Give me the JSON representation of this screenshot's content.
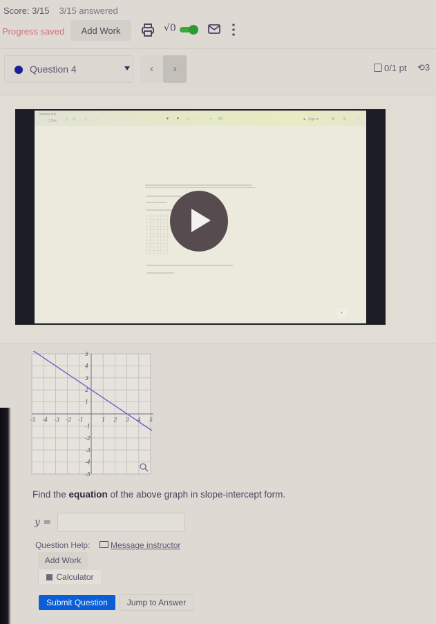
{
  "header": {
    "score": "Score: 3/15",
    "answered": "3/15 answered",
    "progress_status": "Progress saved",
    "add_work_label": "Add Work",
    "sqrt_label": "√0",
    "toggle_state": "on",
    "icons": [
      "printer-icon",
      "sqrt-icon",
      "toggle",
      "mail-icon",
      "kebab-menu-icon"
    ],
    "colors": {
      "progress": "#d4707a",
      "toggle": "#2f9a34"
    }
  },
  "question_nav": {
    "selected": "Question 4",
    "status_dot_color": "#1d1f9a",
    "prev_label": "‹",
    "next_label": "›",
    "points": "0/1 pt",
    "retries": "3"
  },
  "video": {
    "title": "Graphing Text",
    "toolbar_left": "1 Sec",
    "toolbar_right": "Sign in",
    "play_label": "Play video"
  },
  "graph": {
    "x_ticks": [
      "-5",
      "-4",
      "-3",
      "-2",
      "-1",
      "1",
      "2",
      "3",
      "4",
      "5"
    ],
    "y_ticks": [
      "5",
      "4",
      "3",
      "2",
      "1",
      "-1",
      "-2",
      "-3",
      "-4",
      "-5"
    ],
    "xlim": [
      -5,
      5
    ],
    "ylim": [
      -5,
      5
    ],
    "line": {
      "slope": -0.6667,
      "intercept": 2,
      "color": "#6a63c8"
    }
  },
  "chart_data": {
    "type": "line",
    "title": "",
    "xlabel": "",
    "ylabel": "",
    "xlim": [
      -5,
      5
    ],
    "ylim": [
      -5,
      5
    ],
    "grid": true,
    "x_ticks": [
      -5,
      -4,
      -3,
      -2,
      -1,
      1,
      2,
      3,
      4,
      5
    ],
    "y_ticks": [
      5,
      4,
      3,
      2,
      1,
      -1,
      -2,
      -3,
      -4,
      -5
    ],
    "series": [
      {
        "name": "line",
        "x": [
          -5,
          0,
          3,
          5
        ],
        "y": [
          5.33,
          2,
          0,
          -1.33
        ]
      }
    ]
  },
  "question": {
    "prompt_before": "Find the ",
    "prompt_bold": "equation",
    "prompt_after": " of the above graph in slope-intercept form.",
    "y_label": "y =",
    "answer_value": "",
    "answer_placeholder": ""
  },
  "help": {
    "label": "Question Help:",
    "message_link": "Message instructor",
    "add_work_label": "Add Work",
    "calculator_label": "Calculator"
  },
  "actions": {
    "submit_label": "Submit Question",
    "jump_label": "Jump to Answer",
    "submit_color": "#0b5fd6"
  }
}
